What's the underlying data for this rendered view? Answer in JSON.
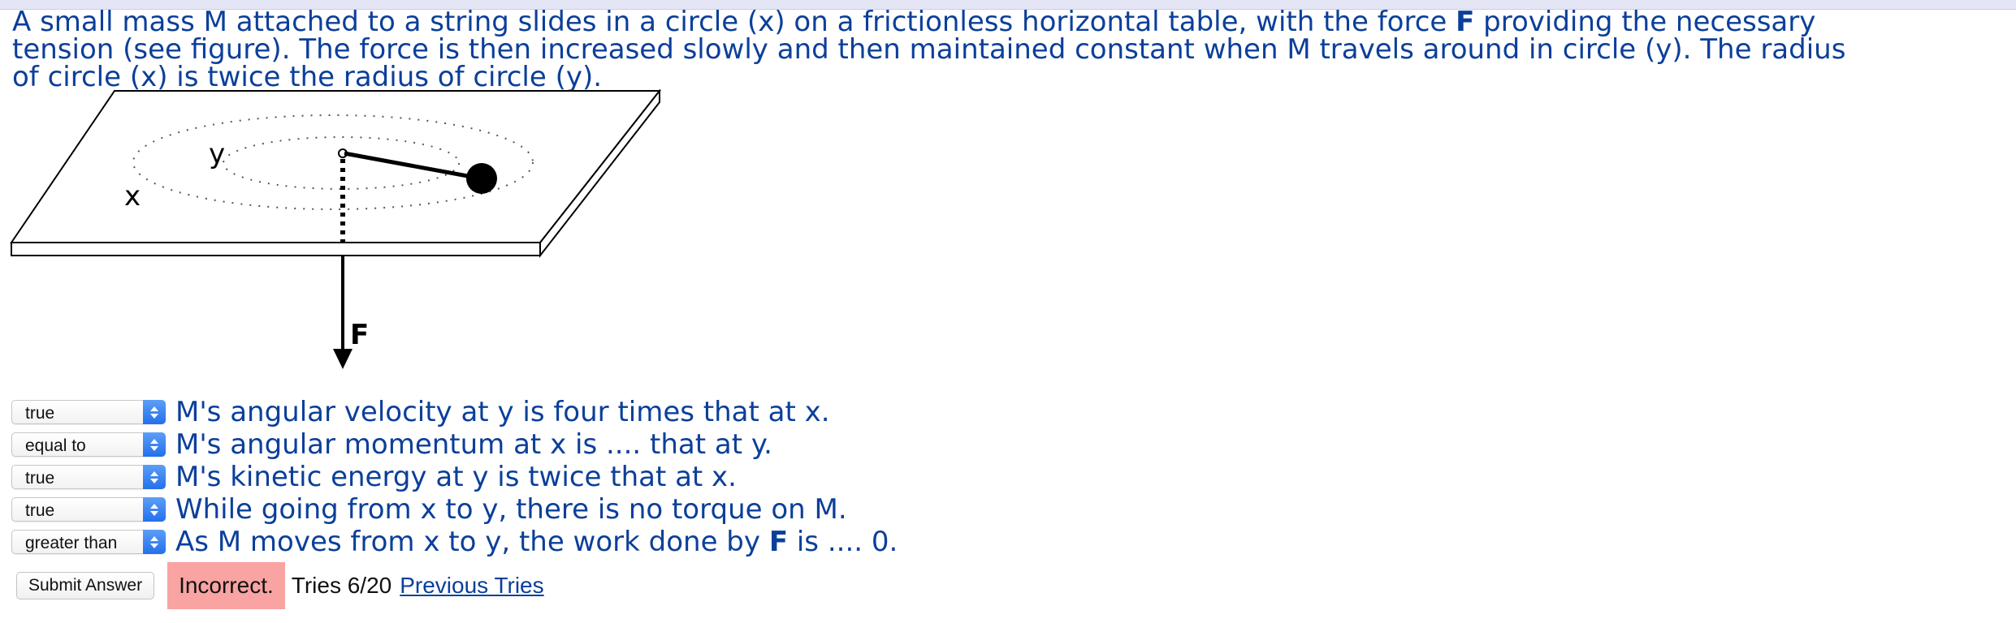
{
  "question": {
    "part1": "A small mass M attached to a string slides in a circle (x) on a frictionless horizontal table, with the force ",
    "force_symbol": "F",
    "part2": " providing the necessary\ntension (see figure). The force is then increased slowly and then maintained constant when M travels around in circle (y). The radius\nof circle (x) is twice the radius of circle (y)."
  },
  "figure": {
    "label_x": "x",
    "label_y": "y",
    "label_force": "F"
  },
  "statements": [
    {
      "selected": "true",
      "text": "M's angular velocity at y is four times that at x."
    },
    {
      "selected": "equal to",
      "text": "M's angular momentum at x is .... that at y."
    },
    {
      "selected": "true",
      "text": "M's kinetic energy at y is twice that at x."
    },
    {
      "selected": "true",
      "text": "While going from x to y, there is no torque on M."
    },
    {
      "selected": "greater than",
      "text_before": "As M moves from x to y, the work done by ",
      "text_bold": "F",
      "text_after": " is .... 0."
    }
  ],
  "actions": {
    "submit_label": "Submit Answer",
    "result": "Incorrect.",
    "tries": "Tries 6/20",
    "previous_tries_link": "Previous Tries"
  },
  "colors": {
    "question_text": "#0b3f9a",
    "incorrect_bg": "#f9a3a3",
    "select_arrows": "#2f7ef0"
  }
}
